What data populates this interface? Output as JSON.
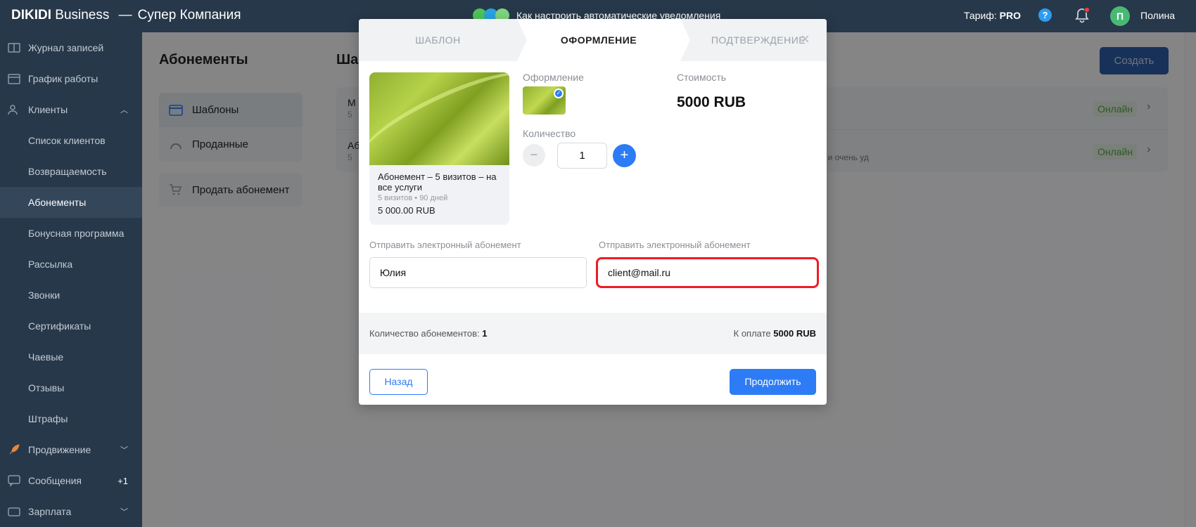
{
  "topbar": {
    "brand": "DIKIDI",
    "brand_suffix": "Business",
    "separator": "—",
    "company": "Супер Компания",
    "notice": "Как настроить автоматические уведомления",
    "tariff_label": "Тариф:",
    "tariff_value": "PRO",
    "help": "?",
    "avatar_letter": "П",
    "user_name": "Полина"
  },
  "sidebar": {
    "items": [
      {
        "label": "Журнал записей"
      },
      {
        "label": "График работы"
      },
      {
        "label": "Клиенты"
      },
      {
        "label": "Список клиентов"
      },
      {
        "label": "Возвращаемость"
      },
      {
        "label": "Абонементы"
      },
      {
        "label": "Бонусная программа"
      },
      {
        "label": "Рассылка"
      },
      {
        "label": "Звонки"
      },
      {
        "label": "Сертификаты"
      },
      {
        "label": "Чаевые"
      },
      {
        "label": "Отзывы"
      },
      {
        "label": "Штрафы"
      },
      {
        "label": "Продвижение"
      },
      {
        "label": "Сообщения",
        "badge": "+1"
      },
      {
        "label": "Зарплата"
      }
    ]
  },
  "main": {
    "title": "Абонементы",
    "title2": "Ша",
    "tabs": [
      {
        "label": "Шаблоны"
      },
      {
        "label": "Проданные"
      }
    ],
    "sell_label": "Продать абонемент",
    "create_label": "Создать",
    "rows": [
      {
        "title": "M",
        "sub": "5",
        "desc": "",
        "status": "Онлайн"
      },
      {
        "title": "Аб",
        "sub": "5",
        "desc": "но и очень уд",
        "status": "Онлайн"
      }
    ]
  },
  "modal": {
    "steps": [
      {
        "label": "ШАБЛОН"
      },
      {
        "label": "ОФОРМЛЕНИЕ"
      },
      {
        "label": "ПОДТВЕРЖДЕНИЕ"
      }
    ],
    "close": "×",
    "preview": {
      "name": "Абонемент – 5 визитов – на все услуги",
      "meta": "5 визитов • 90 дней",
      "price": "5 000.00 RUB"
    },
    "design_label": "Оформление",
    "cost_label": "Стоимость",
    "cost_value": "5000 RUB",
    "quantity_label": "Количество",
    "quantity_value": "1",
    "minus": "−",
    "plus": "+",
    "send_label_1": "Отправить электронный абонемент",
    "send_label_2": "Отправить электронный абонемент",
    "name_value": "Юлия",
    "email_value": "client@mail.ru",
    "summary_count_label": "Количество абонементов:",
    "summary_count_value": "1",
    "summary_pay_label": "К оплате",
    "summary_pay_value": "5000 RUB",
    "back_label": "Назад",
    "continue_label": "Продолжить"
  },
  "colors": {
    "topbar": "#27384a",
    "accent": "#2d7cf6",
    "highlight": "#ee1c25",
    "online": "#55a048"
  }
}
